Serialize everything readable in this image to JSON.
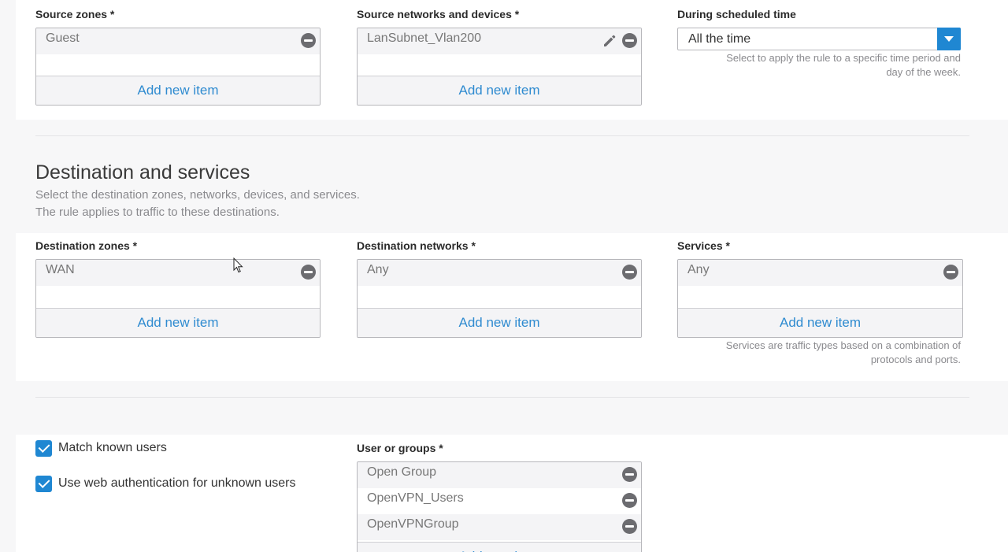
{
  "source": {
    "zones_label": "Source zones *",
    "zones_items": [
      "Guest"
    ],
    "networks_label": "Source networks and devices *",
    "networks_items": [
      "LanSubnet_Vlan200"
    ],
    "schedule_label": "During scheduled time",
    "schedule_value": "All the time",
    "schedule_help_1": "Select to apply the rule to a specific time period and",
    "schedule_help_2": "day of the week."
  },
  "add_new_item": "Add new item",
  "destination": {
    "title": "Destination and services",
    "desc_1": "Select the destination zones, networks, devices, and services.",
    "desc_2": "The rule applies to traffic to these destinations.",
    "zones_label": "Destination zones *",
    "zones_items": [
      "WAN"
    ],
    "networks_label": "Destination networks *",
    "networks_items": [
      "Any"
    ],
    "services_label": "Services *",
    "services_items": [
      "Any"
    ],
    "services_help_1": "Services are traffic types based on a combination of",
    "services_help_2": "protocols and ports."
  },
  "users": {
    "match_known_label": "Match known users",
    "match_known_checked": true,
    "web_auth_label": "Use web authentication for unknown users",
    "web_auth_checked": true,
    "groups_label": "User or groups *",
    "groups_items": [
      "Open Group",
      "OpenVPN_Users",
      "OpenVPNGroup"
    ]
  },
  "icons": {
    "remove": "minus-circle-icon",
    "edit": "pencil-icon",
    "dropdown": "chevron-down-icon",
    "check": "checkmark-icon"
  },
  "colors": {
    "accent": "#1f87d2",
    "link": "#2f8bd0",
    "remove_icon": "#6c6c70"
  }
}
